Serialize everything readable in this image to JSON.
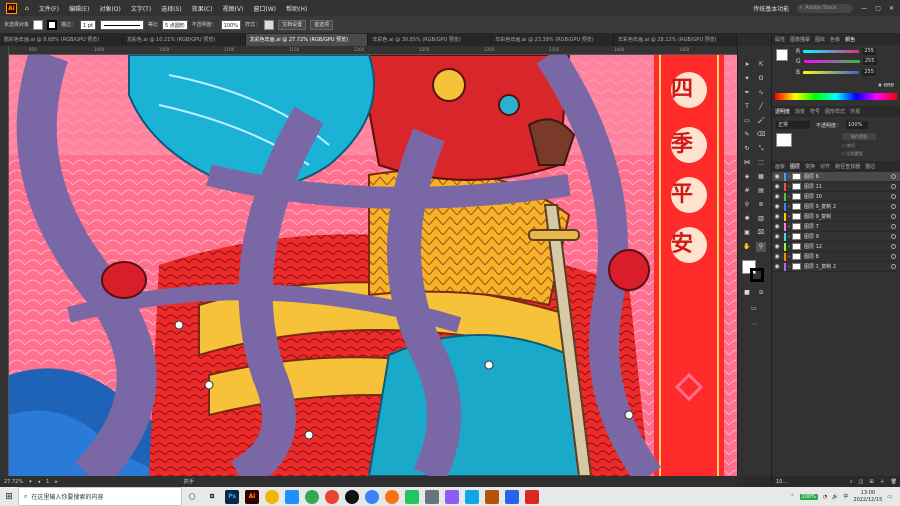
{
  "menubar": {
    "app_logo": "Ai",
    "items": [
      "文件(F)",
      "编辑(E)",
      "对象(O)",
      "文字(T)",
      "选择(S)",
      "效果(C)",
      "视图(V)",
      "窗口(W)",
      "帮助(H)"
    ],
    "workspace": "传统基本功能",
    "search_placeholder": "Adobe Stock"
  },
  "controlbar": {
    "selection_label": "未选择对象",
    "stroke_label": "描边：",
    "stroke_weight": "1 pt",
    "stroke_style": "等比",
    "brush": "5 点圆形",
    "opacity_label": "不透明度：",
    "opacity_value": "100%",
    "style_label": "样式：",
    "doc_setup_button": "文档设置",
    "preferences_button": "首选项"
  },
  "tabs": [
    {
      "label": "腊彩色年画.ai @ 8.68% (RGB/GPU 预览)",
      "active": false
    },
    {
      "label": "龙彩色.ai @ 10.21% (RGB/GPU 预览)",
      "active": false
    },
    {
      "label": "龙彩色年画.ai @ 27.72% (RGB/GPU 预览)",
      "active": true
    },
    {
      "label": "年彩色.ai @ 30.85% (RGB/GPU 预览)",
      "active": false
    },
    {
      "label": "年彩色年画.ai @ 23.39% (RGB/GPU 预览)",
      "active": false
    },
    {
      "label": "年彩色年画.ai @ 28.12% (RGB/GPU 预览)",
      "active": false
    }
  ],
  "ruler_ticks": [
    "950",
    "1000",
    "1050",
    "1100",
    "1150",
    "1200",
    "1250",
    "1300",
    "1350",
    "1400",
    "1450"
  ],
  "canvas_text": [
    "四",
    "季",
    "平",
    "安"
  ],
  "statusbar": {
    "zoom": "27.72%",
    "page": "1",
    "tool": "抓手"
  },
  "color_panel": {
    "tabs": [
      "属性",
      "图像描摹",
      "图库",
      "色板",
      "颜色"
    ],
    "active_tab": "颜色",
    "channels": [
      {
        "label": "R",
        "value": "255",
        "color": "#e0307a"
      },
      {
        "label": "G",
        "value": "255",
        "color": "#35c04d"
      },
      {
        "label": "B",
        "value": "255",
        "color": "#3d5ee0"
      }
    ],
    "hex": "ffffff"
  },
  "transparency_panel": {
    "tabs": [
      "透明度",
      "渐变",
      "符号",
      "图形样式",
      "外观"
    ],
    "mode": "正常",
    "opacity_label": "不透明度：",
    "opacity_value": "100%",
    "buttons": [
      "制作蒙版",
      "剪切",
      "反相蒙版"
    ]
  },
  "layers_panel": {
    "tabs": [
      "画板",
      "图层",
      "变换",
      "对齐",
      "路径查找器",
      "描边"
    ],
    "active_tab": "图层",
    "layers": [
      {
        "name": "图层 6",
        "color": "#4aa0ff",
        "selected": true
      },
      {
        "name": "图层 11",
        "color": "#ff4a4a",
        "selected": false
      },
      {
        "name": "图层 10",
        "color": "#44cc44",
        "selected": false
      },
      {
        "name": "图层 9_复制 2",
        "color": "#4a7aff",
        "selected": false
      },
      {
        "name": "图层 9_复制",
        "color": "#ffcc00",
        "selected": false
      },
      {
        "name": "图层 7",
        "color": "#ff77ff",
        "selected": false
      },
      {
        "name": "图层 9",
        "color": "#44dddd",
        "selected": false
      },
      {
        "name": "图层 12",
        "color": "#99ff33",
        "selected": false
      },
      {
        "name": "图层 8",
        "color": "#ff8800",
        "selected": false
      },
      {
        "name": "图层 1_复制 2",
        "color": "#aa66ff",
        "selected": false
      }
    ],
    "footer": "10..."
  },
  "taskbar": {
    "search_placeholder": "在这里输入你要搜索的内容",
    "apps": [
      {
        "name": "Ps",
        "color": "#0b2640"
      },
      {
        "name": "Ai",
        "color": "#330000"
      },
      {
        "name": "",
        "color": "#f3b500"
      },
      {
        "name": "",
        "color": "#1e90ff"
      },
      {
        "name": "",
        "color": "#34a853"
      },
      {
        "name": "",
        "color": "#ea4335"
      },
      {
        "name": "",
        "color": "#111111"
      },
      {
        "name": "",
        "color": "#3b82f6"
      },
      {
        "name": "",
        "color": "#f97316"
      },
      {
        "name": "",
        "color": "#22c55e"
      },
      {
        "name": "",
        "color": "#6b7280"
      },
      {
        "name": "",
        "color": "#8b5cf6"
      },
      {
        "name": "",
        "color": "#0ea5e9"
      },
      {
        "name": "",
        "color": "#b45309"
      },
      {
        "name": "",
        "color": "#2563eb"
      },
      {
        "name": "",
        "color": "#dc2626"
      }
    ],
    "battery": "100%",
    "ime": "中",
    "time": "13:00",
    "date": "2022/12/15"
  }
}
